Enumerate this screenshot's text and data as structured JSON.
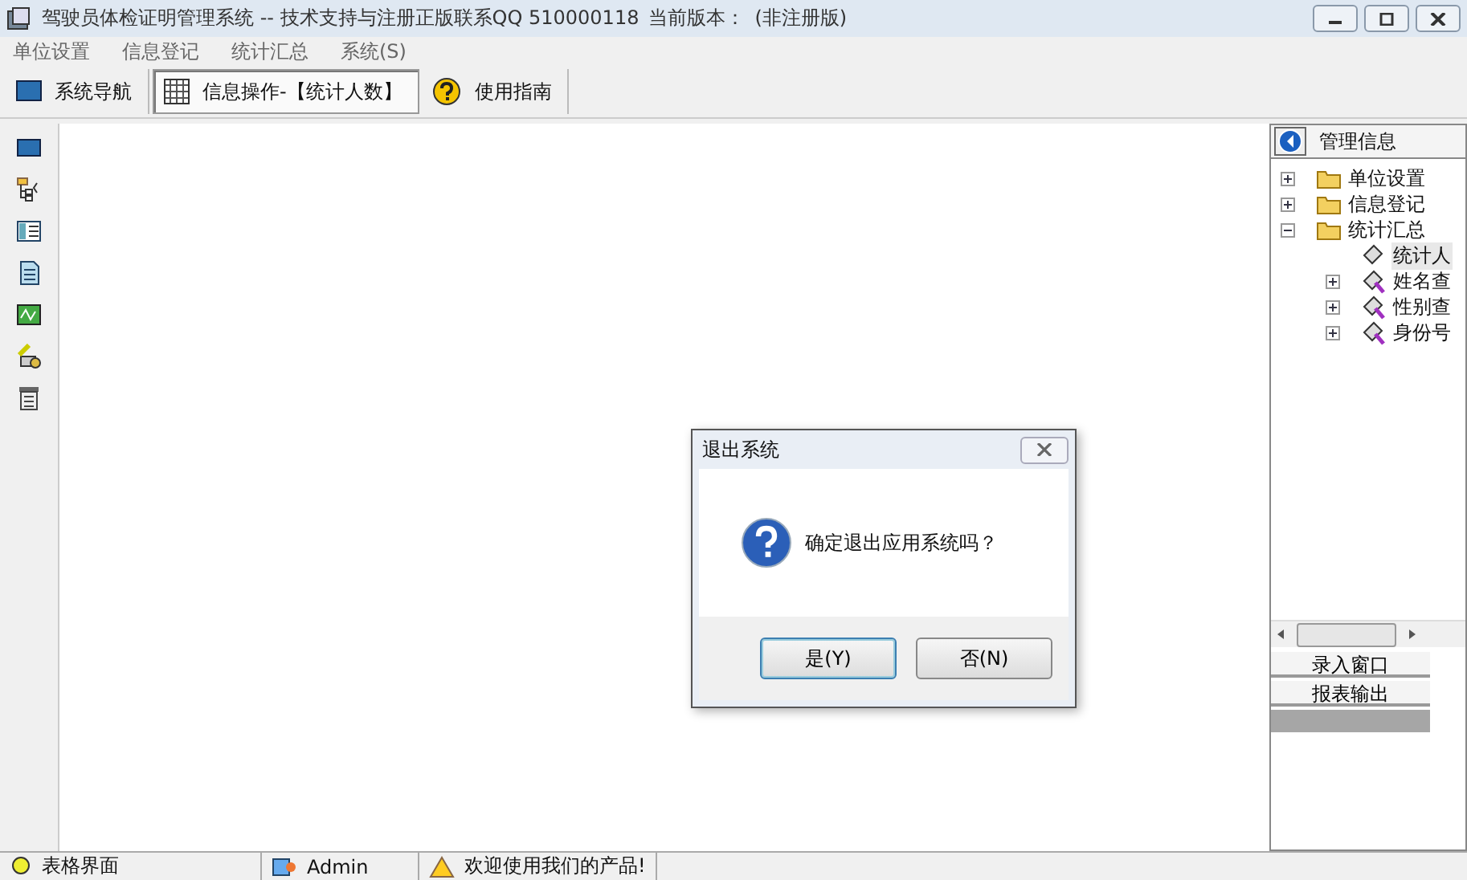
{
  "window": {
    "title": "驾驶员体检证明管理系统 -- 技术支持与注册正版联系QQ 510000118",
    "version_label": "当前版本：",
    "version": "(非注册版)"
  },
  "menu": [
    "单位设置",
    "信息登记",
    "统计汇总",
    "系统(S)"
  ],
  "toolbar": [
    {
      "label": "系统导航",
      "selected": false
    },
    {
      "label": "信息操作-【统计人数】",
      "selected": true
    },
    {
      "label": "使用指南",
      "selected": false
    }
  ],
  "panel": {
    "title": "管理信息",
    "tree": [
      {
        "label": "单位设置",
        "kind": "folder",
        "expanded": false,
        "selected": false
      },
      {
        "label": "信息登记",
        "kind": "folder",
        "expanded": false,
        "selected": false
      },
      {
        "label": "统计汇总",
        "kind": "folder",
        "expanded": true,
        "selected": false,
        "children": [
          {
            "label": "统计人",
            "kind": "leaf",
            "selected": true
          },
          {
            "label": "姓名查",
            "kind": "query",
            "expanded": false,
            "selected": false
          },
          {
            "label": "性别查",
            "kind": "query",
            "expanded": false,
            "selected": false
          },
          {
            "label": "身份号",
            "kind": "query",
            "expanded": false,
            "selected": false
          }
        ]
      }
    ],
    "tabs": [
      {
        "label": "录入窗口"
      },
      {
        "label": "报表输出"
      }
    ]
  },
  "dialog": {
    "title": "退出系统",
    "message": "确定退出应用系统吗？",
    "buttons": [
      {
        "label": "是(Y)",
        "default": true
      },
      {
        "label": "否(N)",
        "default": false
      }
    ]
  },
  "status_bar": [
    {
      "text": "表格界面"
    },
    {
      "text": "Admin"
    },
    {
      "text": "欢迎使用我们的产品!"
    }
  ]
}
